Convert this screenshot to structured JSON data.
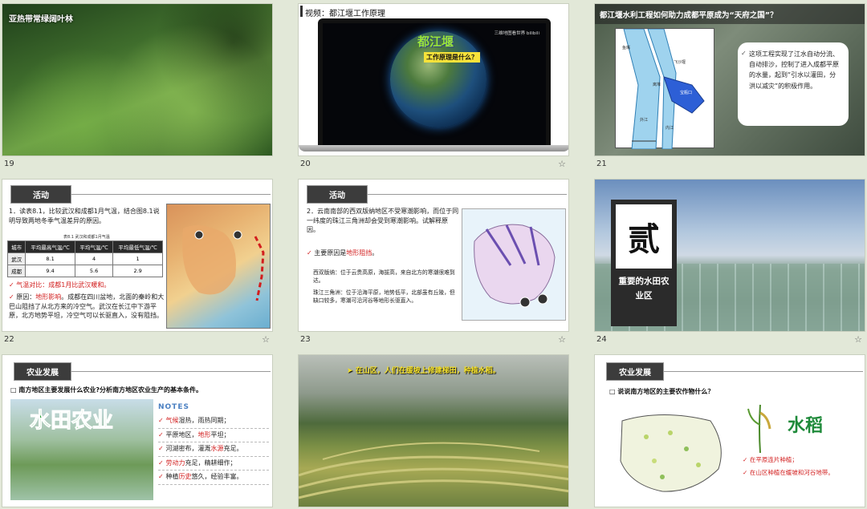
{
  "slides": [
    {
      "num": "19",
      "title": "亚热带常绿阔叶林"
    },
    {
      "num": "20",
      "title": "视频：都江堰工作原理",
      "video_title": "都江堰",
      "video_subtitle": "工作原理是什么？",
      "watermark": "三维地图看世界 bilibili"
    },
    {
      "num": "21",
      "title": "都江堰水利工程如何助力成都平原成为“天府之国”？",
      "callout": "这项工程实现了江水自动分流、自动排沙，控制了进入成都平原的水量，起到“引水以灌田，分洪以减灾”的积极作用。",
      "map_labels": [
        "鱼嘴",
        "飞沙堰",
        "宝瓶口",
        "内江",
        "外江",
        "离堆"
      ]
    },
    {
      "num": "22",
      "tag": "活动",
      "question": "1．读表8.1，比较武汉和成都1月气温，结合图8.1说明导致两地冬季气温差异的原因。",
      "table_caption": "表8.1 武汉和成都1月气温",
      "headers": [
        "城市",
        "平均最高气温/℃",
        "平均气温/℃",
        "平均最低气温/℃"
      ],
      "rows": [
        [
          "武汉",
          "8.1",
          "4",
          "1"
        ],
        [
          "成都",
          "9.4",
          "5.6",
          "2.9"
        ]
      ],
      "answer1_prefix": "气温对比：",
      "answer1": "成都1月比武汉暖和。",
      "answer2_prefix": "原因：",
      "answer2_key": "地形影响",
      "answer2": "。成都在四川盆地，北面的秦岭和大巴山阻挡了从北方来的冷空气。武汉在长江中下游平原，北方地势平坦，冷空气可以长驱直入，没有阻挡。"
    },
    {
      "num": "23",
      "tag": "活动",
      "question": "2．云南南部的西双版纳地区不受寒潮影响，而位于同一纬度的珠江三角洲却会受到寒潮影响。试解释原因。",
      "answer_prefix": "主要原因是",
      "answer_key": "地形阻挡",
      "answer_suffix": "。",
      "detail1": "西双版纳：位于云贵高原，海拔高，来自北方的寒潮很难到达。",
      "detail2": "珠江三角洲：位于沿海平原，地势低平，北部虽有丘陵，但缺口较多，寒潮可沿河谷等地形长驱直入。"
    },
    {
      "num": "24",
      "big_char": "贰",
      "subtitle": "重要的水田农业区"
    },
    {
      "num": "",
      "tag": "农业发展",
      "question": "南方地区主要发展什么农业?分析南方地区农业生产的基本条件。",
      "big_title": "水田农业",
      "notes_title": "NOTES",
      "notes": [
        {
          "key": "气候",
          "rest": "湿热，雨热同期；"
        },
        {
          "pre": "平原地区，",
          "key": "地形",
          "rest": "平坦；"
        },
        {
          "pre": "河湖密布，灌溉",
          "key": "水源",
          "rest": "充足。"
        },
        {
          "key": "劳动力",
          "rest": "充足，精耕细作；"
        },
        {
          "pre": "种植",
          "key": "历史",
          "rest": "悠久，经验丰富。"
        }
      ]
    },
    {
      "num": "",
      "caption": "在山区，人们在缓坡上修建梯田，种植水稻。"
    },
    {
      "num": "",
      "tag": "农业发展",
      "question": "说说南方地区的主要农作物什么？",
      "crop": "水稻",
      "answers": [
        "在平原连片种植；",
        "在山区种植在缓坡和河谷地带。"
      ]
    }
  ]
}
